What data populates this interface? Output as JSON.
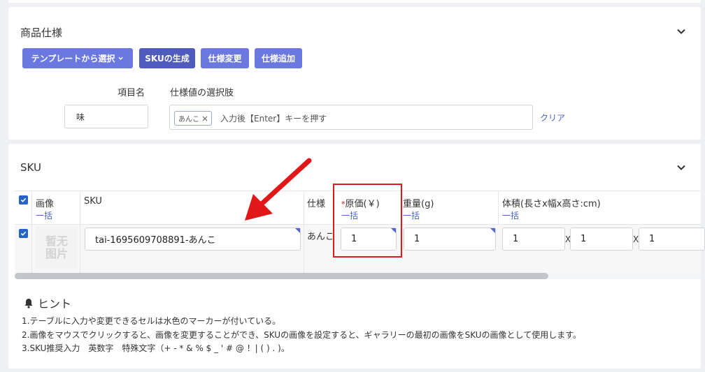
{
  "spec_section": {
    "title": "商品仕様",
    "buttons": {
      "template": "テンプレートから選択",
      "generate_sku": "SKUの生成",
      "change_spec": "仕様変更",
      "add_spec": "仕様追加"
    },
    "labels": {
      "item_name": "項目名",
      "spec_options": "仕様値の選択肢"
    },
    "item_name_value": "味",
    "tag": "あんこ",
    "options_placeholder": "入力後【Enter】キーを押す",
    "clear_link": "クリア"
  },
  "sku_section": {
    "title": "SKU",
    "columns": {
      "image": "画像",
      "sku": "SKU",
      "spec": "仕様",
      "cost_required": "*",
      "cost": "原価(￥)",
      "weight": "重量(g)",
      "volume": "体積(長さx幅x高さ:cm)"
    },
    "bulk_label": "一括",
    "row": {
      "image_placeholder_line1": "暂无",
      "image_placeholder_line2": "图片",
      "sku": "tai-1695609708891-あんこ",
      "spec": "あんこ",
      "cost": "1",
      "weight": "1",
      "length": "1",
      "width": "1",
      "height": "1",
      "separator": "X"
    }
  },
  "hint": {
    "title": "ヒント",
    "lines": [
      "1.テーブルに入力や変更できるセルは水色のマーカーが付いている。",
      "2.画像をマウスでクリックすると、画像を変更することができ、SKUの画像を設定すると、ギャラリーの最初の画像をSKUの画像として使用します。",
      "3.SKU推奨入力　英数字　特殊文字（+ - * & % $ _ ' # @ ！| ( ) . )。"
    ]
  },
  "colors": {
    "primary": "#6a78e0",
    "primary_dark": "#4f5bbd",
    "link": "#4a63c9",
    "highlight": "#e01818"
  }
}
